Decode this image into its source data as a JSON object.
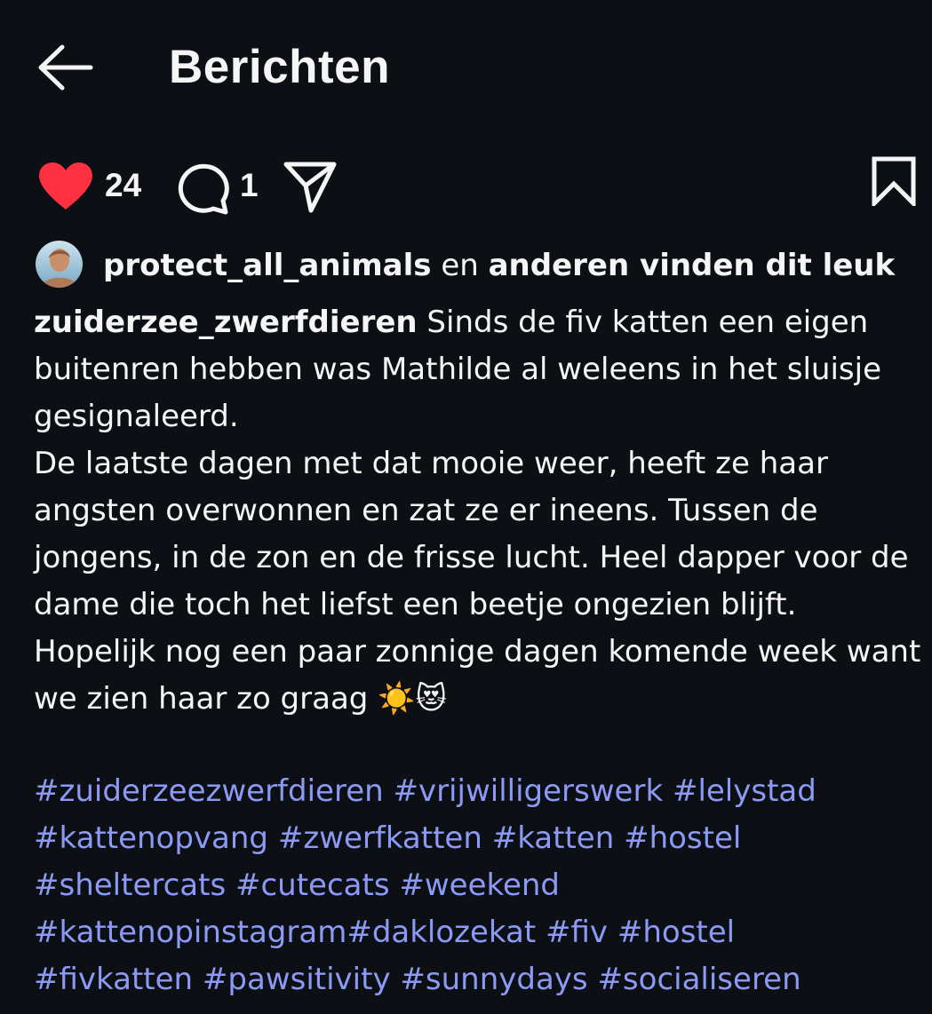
{
  "header": {
    "title": "Berichten",
    "back_icon": "arrow-left-icon"
  },
  "actions": {
    "like_icon": "heart-filled-icon",
    "like_color": "#ff3040",
    "like_count": "24",
    "comment_icon": "comment-bubble-icon",
    "comment_count": "1",
    "share_icon": "paper-plane-icon",
    "save_icon": "bookmark-icon"
  },
  "likes": {
    "user": "protect_all_animals",
    "connector": " en ",
    "rest": "anderen vinden dit leuk"
  },
  "caption": {
    "author": "zuiderzee_zwerfdieren",
    "text": " Sinds de fiv katten een eigen buitenren hebben was Mathilde al weleens in het sluisje gesignaleerd.\nDe laatste dagen met dat mooie weer, heeft ze haar angsten overwonnen en zat ze er ineens. Tussen de jongens, in de zon en de frisse lucht. Heel dapper voor de dame die toch het liefst een beetje ongezien blijft. Hopelijk nog een paar zonnige dagen komende week want we zien haar zo graag ☀️😻"
  },
  "hashtags": {
    "color": "#8c9af5",
    "lines": [
      [
        "#zuiderzeezwerfdieren",
        " ",
        "#vrijwilligerswerk",
        " ",
        "#lelystad"
      ],
      [
        "#kattenopvang",
        " ",
        "#zwerfkatten",
        " ",
        "#katten",
        " ",
        "#hostel"
      ],
      [
        "#sheltercats",
        " ",
        "#cutecats",
        " ",
        "#weekend"
      ],
      [
        "#kattenopinstagram",
        "#daklozekat",
        " ",
        "#fiv",
        " ",
        "#hostel"
      ],
      [
        "#fivkatten",
        " ",
        "#pawsitivity",
        " ",
        "#sunnydays",
        " ",
        "#socialiseren"
      ]
    ]
  }
}
